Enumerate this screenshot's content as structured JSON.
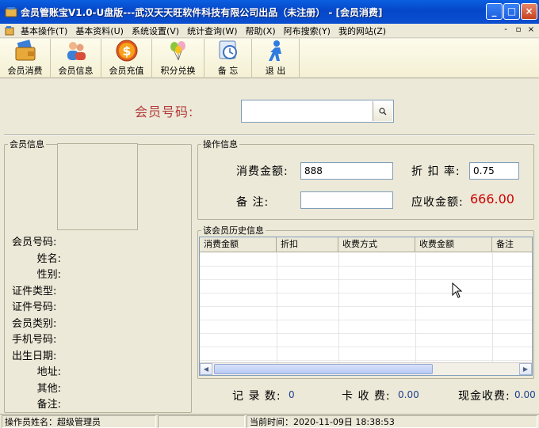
{
  "window": {
    "title": "会员管账宝V1.0-U盘版---武汉天天旺软件科技有限公司出品（未注册） - [会员消费]",
    "minimize": "_",
    "maximize": "□",
    "close": "×"
  },
  "menu": {
    "items": [
      "基本操作(T)",
      "基本资料(U)",
      "系统设置(V)",
      "统计查询(W)",
      "帮助(X)",
      "阿布搜索(Y)",
      "我的网站(Z)"
    ],
    "mdi": [
      "-",
      "▫",
      "×"
    ]
  },
  "toolbar": {
    "items": [
      {
        "label": "会员消费",
        "icon": "card-wallet-icon"
      },
      {
        "label": "会员信息",
        "icon": "users-icon"
      },
      {
        "label": "会员充值",
        "icon": "coin-dollar-icon"
      },
      {
        "label": "积分兑换",
        "icon": "balloons-icon"
      },
      {
        "label": "备 忘",
        "icon": "memo-icon"
      },
      {
        "label": "退 出",
        "icon": "exit-person-icon"
      }
    ]
  },
  "member_lookup": {
    "label": "会员号码:",
    "value": ""
  },
  "member_info": {
    "legend": "会员信息",
    "fields": [
      "会员号码:",
      "姓名:",
      "性别:",
      "证件类型:",
      "证件号码:",
      "会员类别:",
      "手机号码:",
      "出生日期:",
      "地址:",
      "其他:",
      "备注:"
    ]
  },
  "operation": {
    "legend": "操作信息",
    "amount_label": "消费金额:",
    "amount_value": "888",
    "discount_label": "折 扣 率:",
    "discount_value": "0.75",
    "note_label": "备    注:",
    "note_value": "",
    "due_label": "应收金额:",
    "due_value": "666.00"
  },
  "history": {
    "legend": "该会员历史信息",
    "columns": [
      "消费金额",
      "折扣",
      "收费方式",
      "收费金额",
      "备注"
    ]
  },
  "stats": {
    "records_label": "记 录 数:",
    "records_value": "0",
    "card_label": "卡 收 费:",
    "card_value": "0.00",
    "cash_label": "现金收费:",
    "cash_value": "0.00"
  },
  "status": {
    "operator": "操作员姓名：超级管理员",
    "time": "当前时间：2020-11-09日 18:38:53"
  },
  "colors": {
    "accent_red": "#cc0000",
    "label_red": "#b23a3a",
    "value_blue": "#1f3f8f"
  }
}
